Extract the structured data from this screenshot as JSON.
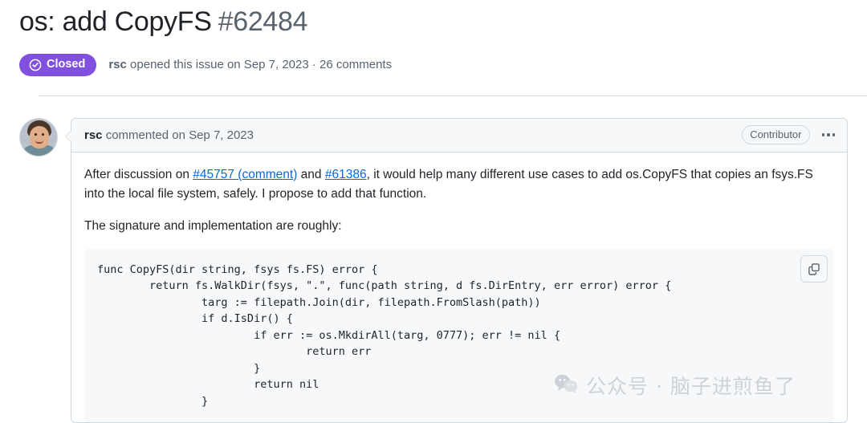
{
  "issue": {
    "title": "os: add CopyFS",
    "number": "#62484",
    "state_label": "Closed",
    "state_icon": "check-circle-icon",
    "state_color": "#8250df",
    "author": "rsc",
    "meta_suffix": " opened this issue on Sep 7, 2023 · 26 comments"
  },
  "comment": {
    "author": "rsc",
    "byline_suffix": " commented on Sep 7, 2023",
    "association_badge": "Contributor",
    "menu_icon": "kebab-horizontal-icon",
    "avatar_alt": "rsc",
    "paragraph1": {
      "before_link1": "After discussion on ",
      "link1": "#45757 (comment)",
      "between_links": " and ",
      "link2": "#61386",
      "after_link2": ", it would help many different use cases to add os.CopyFS that copies an fsys.FS into the local file system, safely. I propose to add that function."
    },
    "paragraph2": "The signature and implementation are roughly:",
    "code": "func CopyFS(dir string, fsys fs.FS) error {\n        return fs.WalkDir(fsys, \".\", func(path string, d fs.DirEntry, err error) error {\n                targ := filepath.Join(dir, filepath.FromSlash(path))\n                if d.IsDir() {\n                        if err := os.MkdirAll(targ, 0777); err != nil {\n                                return err\n                        }\n                        return nil\n                }",
    "copy_button_icon": "copy-icon"
  },
  "watermark": {
    "icon": "wechat-icon",
    "text": "公众号 · 脑子进煎鱼了"
  }
}
